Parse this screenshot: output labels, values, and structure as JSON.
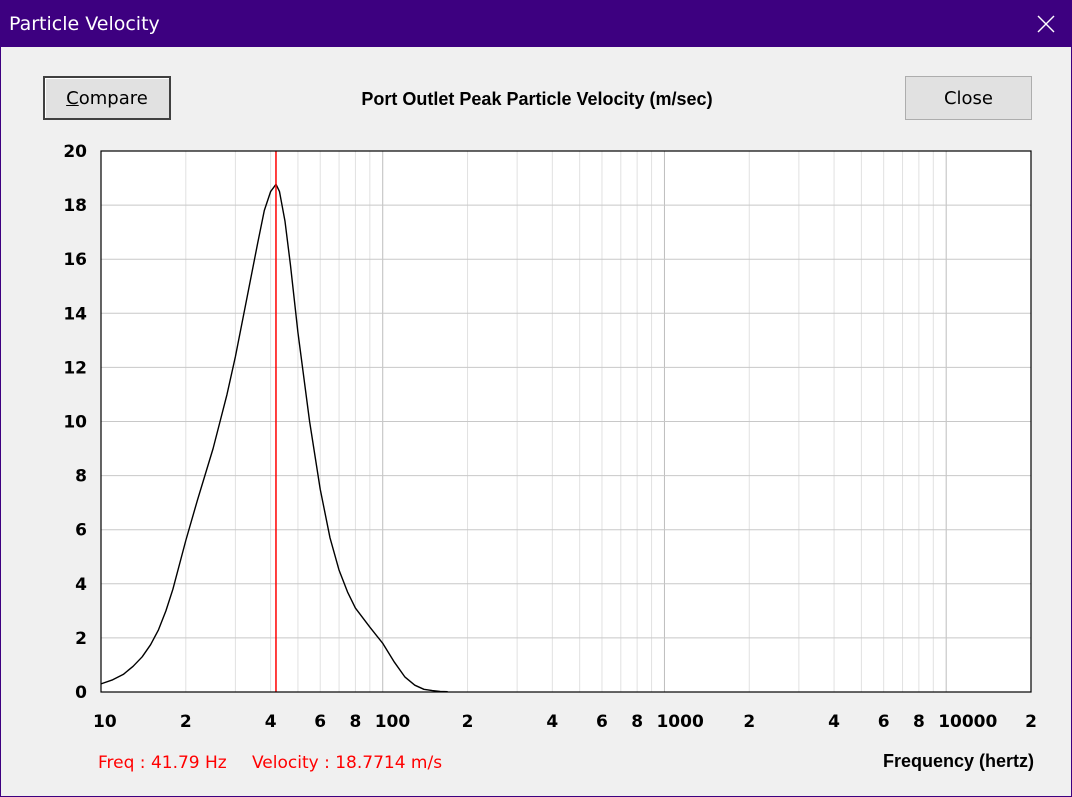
{
  "window": {
    "title": "Particle Velocity"
  },
  "buttons": {
    "compare_prefix": "C",
    "compare_rest": "ompare",
    "close": "Close"
  },
  "readout": {
    "freq": "Freq : 41.79 Hz",
    "velocity": "Velocity : 18.7714 m/s"
  },
  "icons": {
    "close": "close-x-icon"
  },
  "colors": {
    "titlebar": "#3d0080",
    "curve": "#000000",
    "cursor": "#ff0000",
    "grid": "#c8c8c8"
  },
  "chart_data": {
    "type": "line",
    "title": "Port Outlet Peak Particle Velocity (m/sec)",
    "xlabel": "Frequency (hertz)",
    "ylabel": "",
    "x_scale": "log",
    "xlim": [
      10,
      20000
    ],
    "ylim": [
      0,
      20
    ],
    "grid": true,
    "y_ticks": [
      0,
      2,
      4,
      6,
      8,
      10,
      12,
      14,
      16,
      18,
      20
    ],
    "x_tick_labels": [
      {
        "value": 10,
        "label": "10"
      },
      {
        "value": 20,
        "label": "2"
      },
      {
        "value": 40,
        "label": "4"
      },
      {
        "value": 60,
        "label": "6"
      },
      {
        "value": 80,
        "label": "8"
      },
      {
        "value": 100,
        "label": "100"
      },
      {
        "value": 200,
        "label": "2"
      },
      {
        "value": 400,
        "label": "4"
      },
      {
        "value": 600,
        "label": "6"
      },
      {
        "value": 800,
        "label": "8"
      },
      {
        "value": 1000,
        "label": "1000"
      },
      {
        "value": 2000,
        "label": "2"
      },
      {
        "value": 4000,
        "label": "4"
      },
      {
        "value": 6000,
        "label": "6"
      },
      {
        "value": 8000,
        "label": "8"
      },
      {
        "value": 10000,
        "label": "10000"
      },
      {
        "value": 20000,
        "label": "2"
      }
    ],
    "cursor": {
      "x": 41.79,
      "y": 18.7714
    },
    "series": [
      {
        "x": [
          10,
          11,
          12,
          13,
          14,
          15,
          16,
          17,
          18,
          20,
          22,
          25,
          28,
          30,
          33,
          36,
          38,
          40,
          41.79,
          43,
          45,
          47,
          50,
          55,
          60,
          65,
          70,
          75,
          80,
          90,
          100,
          110,
          120,
          130,
          140,
          150,
          160,
          170
        ],
        "y": [
          0.3,
          0.45,
          0.65,
          0.95,
          1.3,
          1.75,
          2.3,
          3.0,
          3.8,
          5.6,
          7.1,
          9.0,
          11.0,
          12.4,
          14.6,
          16.6,
          17.8,
          18.5,
          18.77,
          18.5,
          17.4,
          15.8,
          13.3,
          10.0,
          7.5,
          5.7,
          4.5,
          3.7,
          3.1,
          2.4,
          1.8,
          1.1,
          0.55,
          0.25,
          0.1,
          0.05,
          0.02,
          0.01
        ]
      }
    ]
  }
}
